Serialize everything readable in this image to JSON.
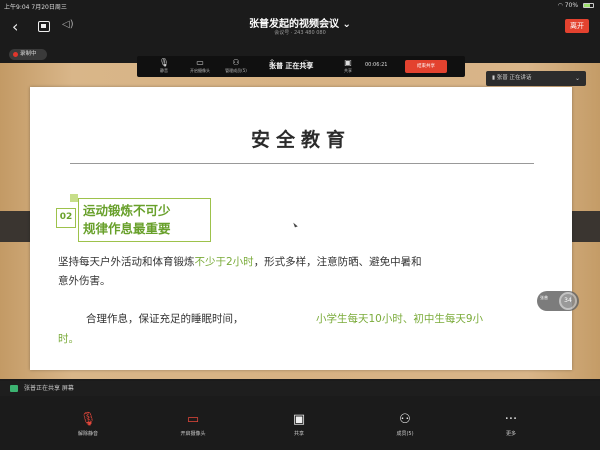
{
  "status_bar": {
    "time": "上午9:04",
    "date": "7月20日周三",
    "battery": "70%",
    "battery_level": 0.7
  },
  "header": {
    "title": "张普发起的视频会议",
    "subtitle": "会议号 · 243 480 080",
    "leave_button": "离开",
    "title_chevron": "chevron-down-icon"
  },
  "recording": {
    "label": "录制中"
  },
  "float_toolbar": {
    "items": [
      {
        "label": "静音",
        "icon": "mic-icon"
      },
      {
        "label": "开启摄像头",
        "icon": "camera-icon"
      },
      {
        "label": "管理成员(5)",
        "icon": "members-icon"
      },
      {
        "label": "",
        "icon": "share-icon"
      },
      {
        "label": "",
        "icon": "chat-icon"
      }
    ],
    "sharing_text": "张普 正在共享",
    "share_item": {
      "label": "共享",
      "icon": "share-screen-icon"
    },
    "timer": "00:06:21",
    "stop_button": "结束共享"
  },
  "speaker_panel": {
    "label": "张普 正在讲话"
  },
  "slide": {
    "title": "安全教育",
    "number": "02",
    "heading_line1": "运动锻炼不可少",
    "heading_line2": "规律作息最重要",
    "para1_pre": "坚持每天户外活动和体育锻炼",
    "para1_hl": "不少于2小时",
    "para1_post": "，形式多样，注意防晒、避免中暑和",
    "para1_line2": "意外伤害。",
    "para2_a": "合理作息，保证充足的睡眠时间，",
    "para2_b": "小学生每天10小时、初中生每天9小",
    "para2_c": "时。"
  },
  "float_bubble": {
    "text": "34",
    "label": "张普"
  },
  "share_banner": {
    "text": "张普正在共享 屏幕"
  },
  "bottom_bar": {
    "mic": {
      "label": "解除静音",
      "icon": "mic-muted-icon"
    },
    "camera": {
      "label": "开启摄像头",
      "icon": "camera-off-icon"
    },
    "share": {
      "label": "共享",
      "icon": "share-screen-icon"
    },
    "members": {
      "label": "成员(5)",
      "icon": "add-member-icon"
    },
    "more": {
      "label": "更多",
      "icon": "more-icon"
    }
  }
}
